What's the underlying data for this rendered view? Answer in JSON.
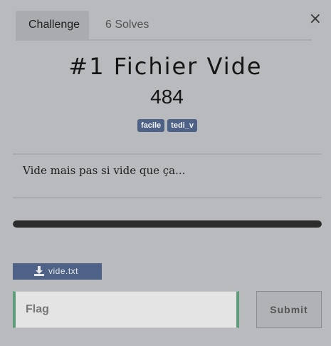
{
  "tabs": [
    {
      "label": "Challenge",
      "active": true
    },
    {
      "label": "6 Solves",
      "active": false
    }
  ],
  "close_label": "×",
  "challenge": {
    "title": "#1 Fichier Vide",
    "points": "484",
    "tags": [
      "facile",
      "tedi_v"
    ],
    "description": "Vide mais pas si vide que ça...",
    "progress": 1.0,
    "file": {
      "name": "vide.txt",
      "icon": "download-icon"
    }
  },
  "form": {
    "flag_placeholder": "Flag",
    "flag_value": "",
    "submit_label": "Submit"
  },
  "colors": {
    "background": "#b8babd",
    "tag": "#4d6286",
    "input_accent": "#5f9c7c",
    "progress": "#2c2c2c"
  }
}
